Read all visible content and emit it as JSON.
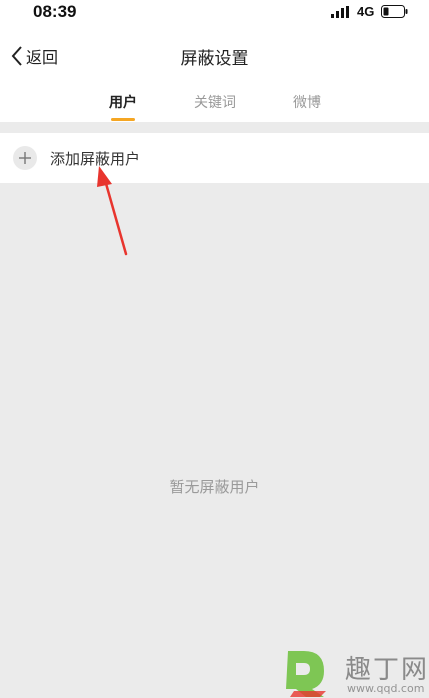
{
  "status_bar": {
    "time": "08:39",
    "network": "4G"
  },
  "nav": {
    "back_label": "返回",
    "title": "屏蔽设置"
  },
  "tabs": [
    {
      "label": "用户",
      "active": true
    },
    {
      "label": "关键词",
      "active": false
    },
    {
      "label": "微博",
      "active": false
    }
  ],
  "add_row": {
    "label": "添加屏蔽用户"
  },
  "empty_state": {
    "text": "暂无屏蔽用户"
  },
  "watermark": {
    "text": "趣丁网",
    "url": "www.qqd.com"
  },
  "colors": {
    "accent": "#f5a623",
    "annotation_arrow": "#e8352e",
    "background": "#ebebeb"
  }
}
